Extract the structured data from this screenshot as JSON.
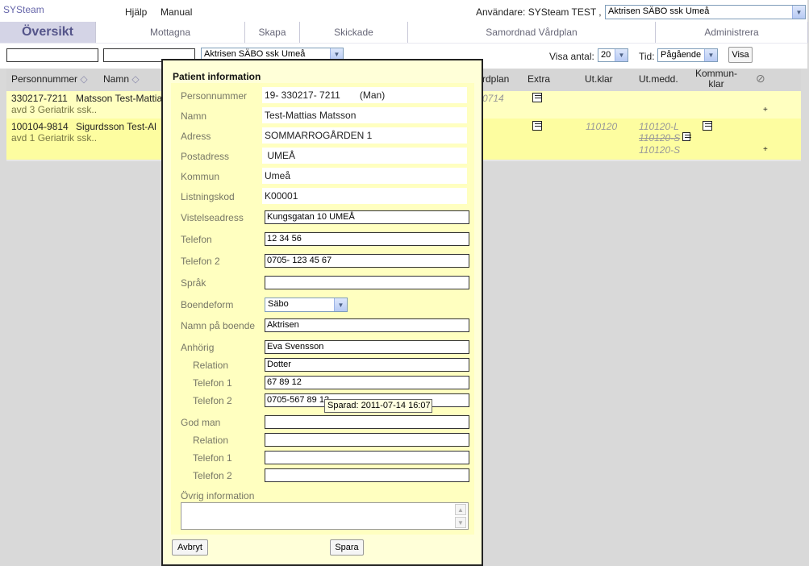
{
  "app": {
    "brand": "SYSteam",
    "menu": [
      "Hjälp",
      "Manual"
    ],
    "user_label": "Användare: SYSteam TEST ,",
    "unit_select": "Aktrisen SÄBO ssk Umeå"
  },
  "tabs": [
    {
      "label": "Översikt",
      "active": true
    },
    {
      "label": "Mottagna"
    },
    {
      "label": "Skapa"
    },
    {
      "label": "Skickade"
    },
    {
      "label": "Samordnad Vårdplan"
    },
    {
      "label": "Administrera"
    }
  ],
  "filters": {
    "unit_select": "Aktrisen SÄBO ssk Umeå",
    "visa_antal_label": "Visa antal:",
    "visa_antal_value": "20",
    "tid_label": "Tid:",
    "tid_value": "Pågående",
    "visa_button": "Visa"
  },
  "grid": {
    "headers": {
      "personnummer": "Personnummer",
      "namn": "Namn",
      "vardplan": "rdplan",
      "extra": "Extra",
      "utklar": "Ut.klar",
      "utmedd": "Ut.medd.",
      "kommunklar_1": "Kommun-",
      "kommunklar_2": "klar"
    },
    "rows": [
      {
        "pnr": "330217-7211",
        "name": "Matsson Test-Mattia",
        "sub": "avd 3 Geriatrik ssk..",
        "vardplan": "0714",
        "plus": "+"
      },
      {
        "pnr": "100104-9814",
        "name": "Sigurdsson Test-Al",
        "sub": "avd 1 Geriatrik ssk..",
        "utklar": "110120",
        "utmedd_1": "110120-L",
        "utmedd_2": "110120-S",
        "utmedd_3": "110120-S",
        "plus": "+"
      }
    ]
  },
  "dialog": {
    "title": "Patient information",
    "fields": {
      "personnummer": {
        "label": "Personnummer",
        "value": "19- 330217- 7211",
        "extra": "(Man)"
      },
      "namn": {
        "label": "Namn",
        "value": "Test-Mattias Matsson"
      },
      "adress": {
        "label": "Adress",
        "value": "SOMMARROGÅRDEN 1"
      },
      "postadress": {
        "label": "Postadress",
        "value": " UMEÅ"
      },
      "kommun": {
        "label": "Kommun",
        "value": "Umeå"
      },
      "listningskod": {
        "label": "Listningskod",
        "value": "K00001"
      },
      "vistelseadress": {
        "label": "Vistelseadress",
        "value": "Kungsgatan 10 UMEÅ"
      },
      "telefon": {
        "label": "Telefon",
        "value": "12 34 56"
      },
      "telefon2": {
        "label": "Telefon 2",
        "value": "0705- 123 45 67"
      },
      "sprak": {
        "label": "Språk",
        "value": ""
      },
      "boendeform": {
        "label": "Boendeform",
        "value": "Säbo"
      },
      "namn_boende": {
        "label": "Namn på boende",
        "value": "Aktrisen"
      },
      "anhorig": {
        "label": "Anhörig",
        "value": "Eva Svensson"
      },
      "anh_relation": {
        "label": "Relation",
        "value": "Dotter"
      },
      "anh_tel1": {
        "label": "Telefon 1",
        "value": "67 89 12"
      },
      "anh_tel2": {
        "label": "Telefon 2",
        "value": "0705-567 89 12"
      },
      "godman": {
        "label": "God man",
        "value": ""
      },
      "gm_relation": {
        "label": "Relation",
        "value": ""
      },
      "gm_tel1": {
        "label": "Telefon 1",
        "value": ""
      },
      "gm_tel2": {
        "label": "Telefon 2",
        "value": ""
      },
      "ovrig": {
        "label": "Övrig information",
        "value": ""
      }
    },
    "tooltip": "Sparad: 2011-07-14 16:07",
    "cancel_button": "Avbryt",
    "save_button": "Spara"
  }
}
